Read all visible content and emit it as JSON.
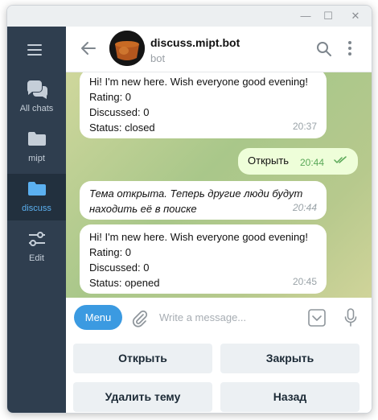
{
  "window": {
    "controls": {
      "minimize": "—",
      "maximize": "☐",
      "close": "✕"
    }
  },
  "sidebar": {
    "items": [
      {
        "label": "All chats",
        "icon": "chat-bubbles-icon"
      },
      {
        "label": "mipt",
        "icon": "folder-icon"
      },
      {
        "label": "discuss",
        "icon": "folder-icon",
        "active": true
      },
      {
        "label": "Edit",
        "icon": "sliders-icon"
      }
    ]
  },
  "header": {
    "title": "discuss.mipt.bot",
    "subtitle": "bot"
  },
  "messages": [
    {
      "lines": [
        "Hi! I'm new here. Wish everyone good evening!",
        "Rating: 0",
        "Discussed: 0",
        "Status: closed"
      ],
      "time": "20:37",
      "direction": "in"
    },
    {
      "lines": [
        "Открыть"
      ],
      "time": "20:44",
      "direction": "out",
      "read": true
    },
    {
      "lines": [
        "Тема открыта. Теперь другие люди будут",
        "находить её в поиске"
      ],
      "time": "20:44",
      "direction": "in",
      "italic": true
    },
    {
      "lines": [
        "Hi! I'm new here. Wish everyone good evening!",
        "Rating: 0",
        "Discussed: 0",
        "Status: opened"
      ],
      "time": "20:45",
      "direction": "in"
    }
  ],
  "composer": {
    "menu_label": "Menu",
    "placeholder": "Write a message..."
  },
  "keyboard": {
    "buttons": [
      "Открыть",
      "Закрыть",
      "Удалить тему",
      "Назад"
    ]
  },
  "colors": {
    "accent": "#3b9ae1",
    "sidebar_bg": "#2f3e4f",
    "sidebar_active_label": "#5bb0f0",
    "outgoing_bubble": "#eefed9"
  }
}
